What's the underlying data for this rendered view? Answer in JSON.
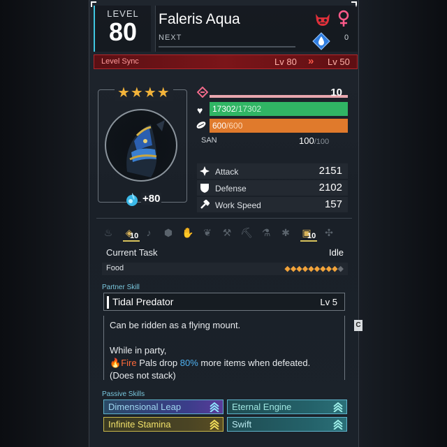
{
  "header": {
    "level_label": "LEVEL",
    "level_value": "80",
    "pal_name": "Faleris Aqua",
    "next_label": "NEXT",
    "next_value": "0",
    "boss_icon": "demon-face-icon",
    "gender_icon": "female-icon",
    "element_icon": "water-element-icon"
  },
  "level_sync": {
    "label": "Level Sync",
    "from": "Lv 80",
    "arrow": "»",
    "to": "Lv 50"
  },
  "portrait": {
    "stars": "★★★★",
    "soul_value": "+80"
  },
  "stats": {
    "trust": "10",
    "hp_current": "17302",
    "hp_max": "/17302",
    "hp_fraction": 1.0,
    "food_current": "600",
    "food_max": "/600",
    "food_fraction": 1.0,
    "san_label": "SAN",
    "san_current": "100",
    "san_max": "/100",
    "attack_label": "Attack",
    "attack_value": "2151",
    "defense_label": "Defense",
    "defense_value": "2102",
    "workspeed_label": "Work Speed",
    "workspeed_value": "157"
  },
  "work": {
    "icons": [
      "kindling",
      "watering",
      "planting",
      "electricity",
      "handiwork",
      "gathering",
      "lumbering",
      "mining",
      "medicine",
      "cooling",
      "transporting",
      "farming"
    ],
    "watering_level": "10",
    "transporting_level": "10",
    "current_task_label": "Current Task",
    "current_task_value": "Idle",
    "food_label": "Food",
    "food_icons_filled": "◆◆◆◆◆◆◆◆◆",
    "food_icons_empty": "◆"
  },
  "partner_skill": {
    "section_label": "Partner Skill",
    "name": "Tidal Predator",
    "level": "Lv 5",
    "line1": "Can be ridden as a flying mount.",
    "line2": "While in party,",
    "line3_fire": "Fire",
    "line3_mid": " Pals drop ",
    "line3_pct": "80%",
    "line3_end": " more items when defeated.",
    "line4": "(Does not stack)",
    "tab": "C"
  },
  "passive_skills": {
    "section_label": "Passive Skills",
    "items": [
      {
        "name": "Dimensional Leap",
        "color": "#9fd6f0"
      },
      {
        "name": "Eternal Engine",
        "color": "#9fe6e0"
      },
      {
        "name": "Infinite Stamina",
        "color": "#f0e06a"
      },
      {
        "name": "Swift",
        "color": "#b8e8ee"
      }
    ]
  }
}
